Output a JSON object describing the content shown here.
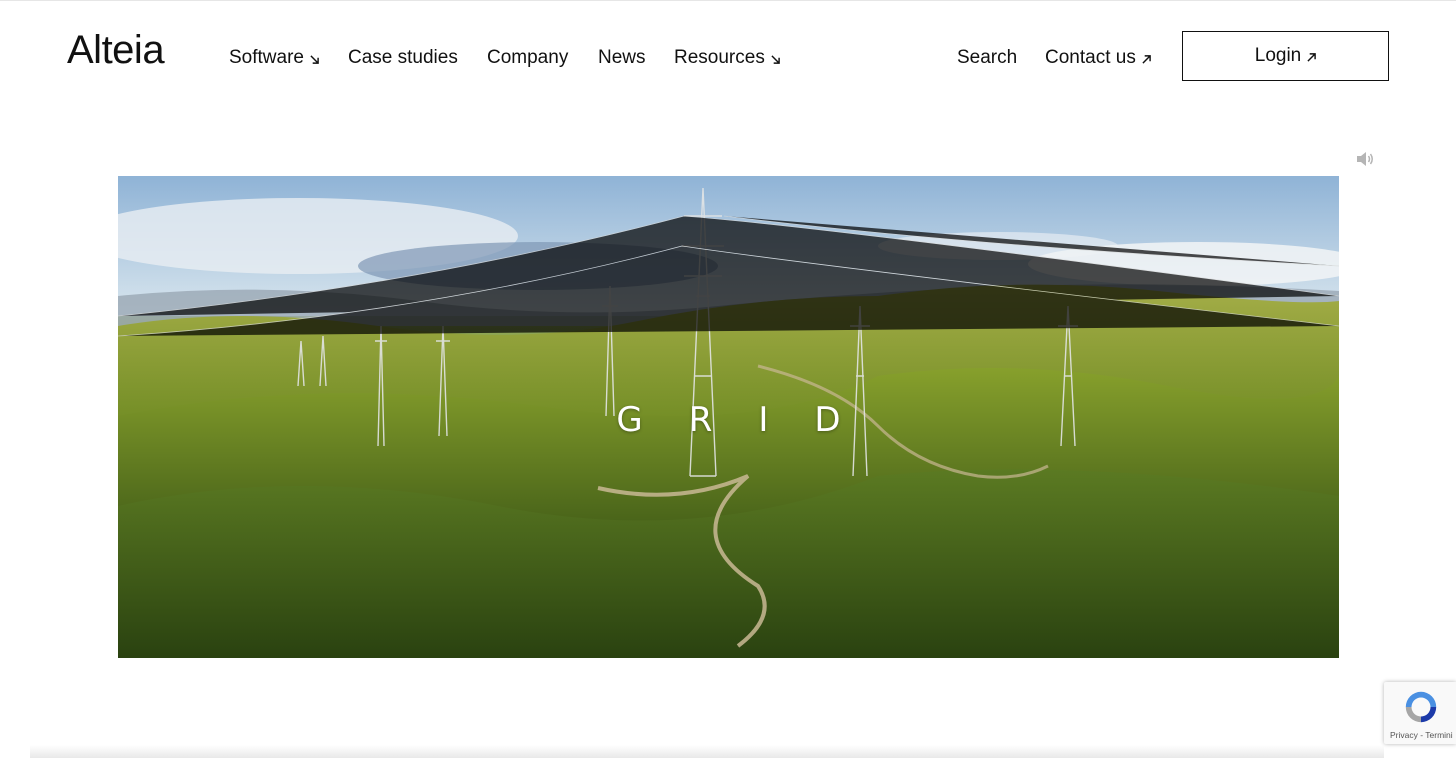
{
  "brand": {
    "logo": "Alteia"
  },
  "nav": {
    "left": [
      {
        "label": "Software",
        "arrow": "down-right"
      },
      {
        "label": "Case studies"
      },
      {
        "label": "Company"
      },
      {
        "label": "News"
      },
      {
        "label": "Resources",
        "arrow": "down-right"
      }
    ],
    "search": "Search",
    "contact": "Contact us",
    "login": "Login"
  },
  "hero": {
    "title": "GRID",
    "sound_icon": "speaker-volume-icon",
    "image": "aerial view of green hills with power line towers"
  },
  "recaptcha": {
    "privacy": "Privacy",
    "separator": " - ",
    "terms": "Termini"
  },
  "colors": {
    "text": "#111111",
    "background": "#ffffff",
    "hero_title": "#ffffff"
  }
}
